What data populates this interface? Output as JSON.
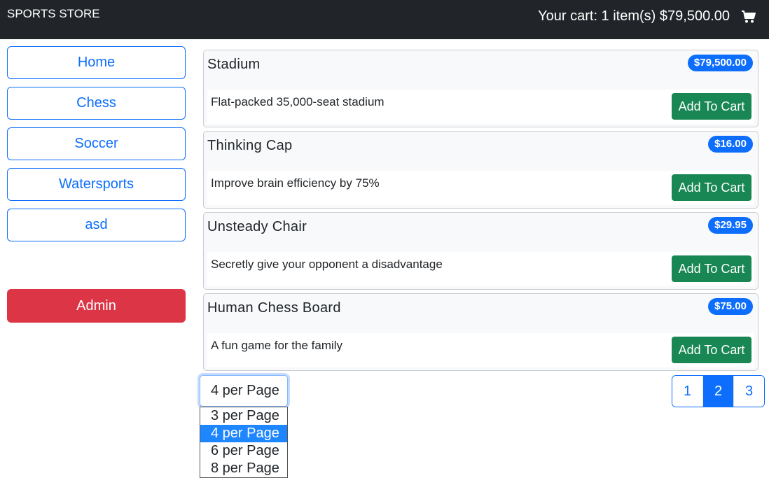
{
  "navbar": {
    "brand": "SPORTS STORE",
    "cart_summary": "Your cart: 1 item(s) $79,500.00",
    "cart_icon": "shopping-cart-icon"
  },
  "sidebar": {
    "categories": [
      "Home",
      "Chess",
      "Soccer",
      "Watersports",
      "asd"
    ],
    "admin_label": "Admin"
  },
  "products": [
    {
      "name": "Stadium",
      "price": "$79,500.00",
      "description": "Flat-packed 35,000-seat stadium",
      "button": "Add To Cart"
    },
    {
      "name": "Thinking Cap",
      "price": "$16.00",
      "description": "Improve brain efficiency by 75%",
      "button": "Add To Cart"
    },
    {
      "name": "Unsteady Chair",
      "price": "$29.95",
      "description": "Secretly give your opponent a disadvantage",
      "button": "Add To Cart"
    },
    {
      "name": "Human Chess Board",
      "price": "$75.00",
      "description": "A fun game for the family",
      "button": "Add To Cart"
    }
  ],
  "page_size": {
    "selected": "4 per Page",
    "options": [
      "3 per Page",
      "4 per Page",
      "6 per Page",
      "8 per Page"
    ]
  },
  "pagination": {
    "pages": [
      "1",
      "2",
      "3"
    ],
    "current": "2"
  },
  "colors": {
    "navbar": "#212529",
    "primary": "#0d6efd",
    "danger": "#dc3545",
    "success": "#198754"
  }
}
